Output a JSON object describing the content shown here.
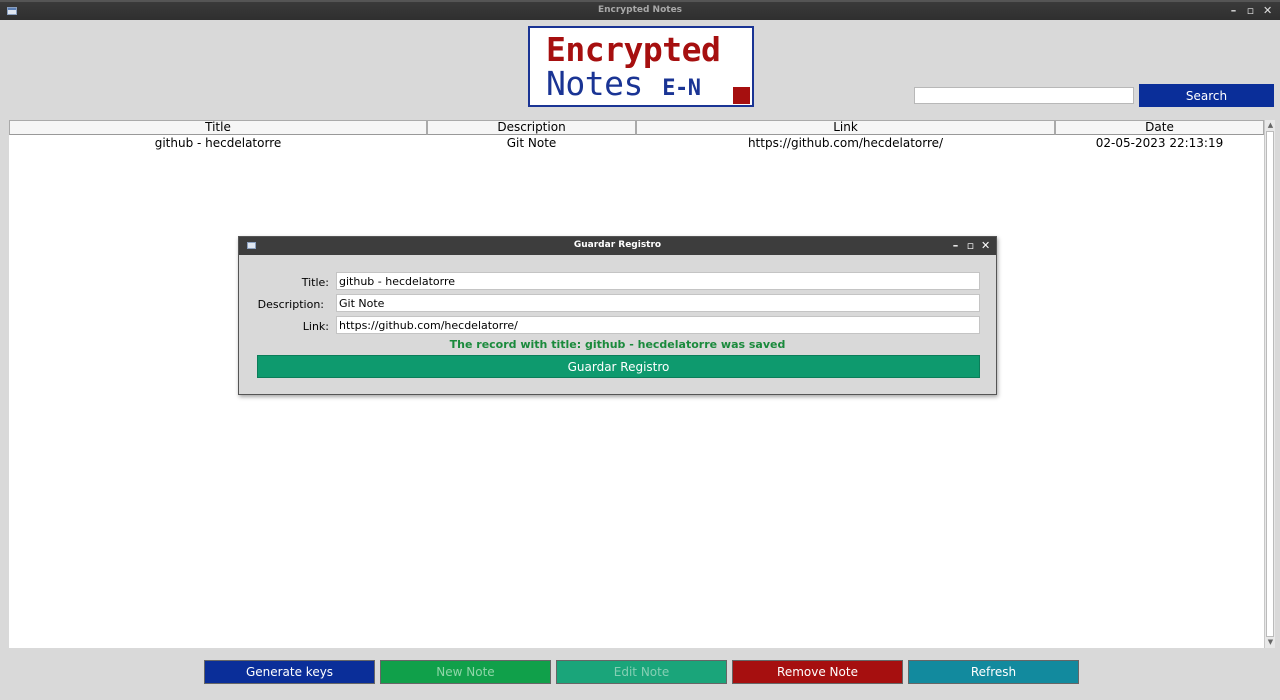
{
  "window": {
    "title": "Encrypted Notes",
    "controls": {
      "minimize": "–",
      "maximize": "▫",
      "close": "✕"
    }
  },
  "logo": {
    "line1": "Encrypted",
    "line2_main": "Notes",
    "line2_suffix": "E-N",
    "colors": {
      "red": "#a60f0f",
      "blue": "#1a3494"
    }
  },
  "search": {
    "value": "",
    "button_label": "Search",
    "button_color": "#0a2e99"
  },
  "table": {
    "columns": [
      "Title",
      "Description",
      "Link",
      "Date"
    ],
    "rows": [
      [
        "github - hecdelatorre",
        "Git Note",
        "https://github.com/hecdelatorre/",
        "02-05-2023 22:13:19"
      ]
    ]
  },
  "dialog": {
    "title": "Guardar Registro",
    "controls": {
      "minimize": "–",
      "maximize": "▫",
      "close": "✕"
    },
    "fields": [
      {
        "label": "Title:",
        "value": "github - hecdelatorre"
      },
      {
        "label": "Description:",
        "value": "Git Note"
      },
      {
        "label": "Link:",
        "value": "https://github.com/hecdelatorre/"
      }
    ],
    "status": "The record with title: github - hecdelatorre was saved",
    "status_color": "#1a8a3c",
    "save_label": "Guardar Registro",
    "save_color": "#0e9a6e"
  },
  "bottom_buttons": [
    {
      "label": "Generate keys",
      "bg": "#0a2e99",
      "fg": "#ffffff"
    },
    {
      "label": "New Note",
      "bg": "#10a04a",
      "fg": "#8fd6a8"
    },
    {
      "label": "Edit Note",
      "bg": "#1aa57a",
      "fg": "#85cfb4"
    },
    {
      "label": "Remove Note",
      "bg": "#a60f0f",
      "fg": "#ffffff"
    },
    {
      "label": "Refresh",
      "bg": "#128a9e",
      "fg": "#ffffff"
    }
  ]
}
